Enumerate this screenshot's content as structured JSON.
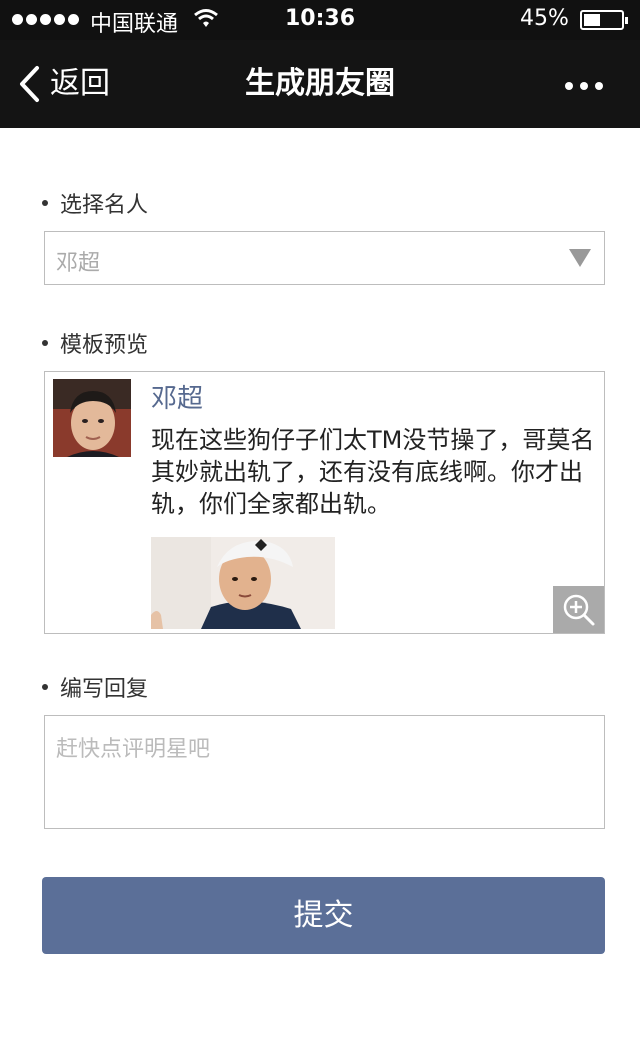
{
  "status_bar": {
    "carrier": "中国联通",
    "time": "10:36",
    "battery": "45%",
    "battery_level": 0.45
  },
  "nav": {
    "back_label": "返回",
    "title": "生成朋友圈"
  },
  "select_section": {
    "label": "选择名人",
    "value": "邓超"
  },
  "preview_section": {
    "label": "模板预览",
    "post": {
      "name": "邓超",
      "text": "现在这些狗仔子们太TM没节操了，哥莫名其妙就出轨了，还有没有底线啊。你才出轨，你们全家都出轨。"
    }
  },
  "reply_section": {
    "label": "编写回复",
    "placeholder": "赶快点评明星吧"
  },
  "submit_label": "提交",
  "colors": {
    "nav_bg": "#141414",
    "name_blue": "#56698f",
    "submit_bg": "#5b6f98",
    "border": "#bdbdbd"
  }
}
